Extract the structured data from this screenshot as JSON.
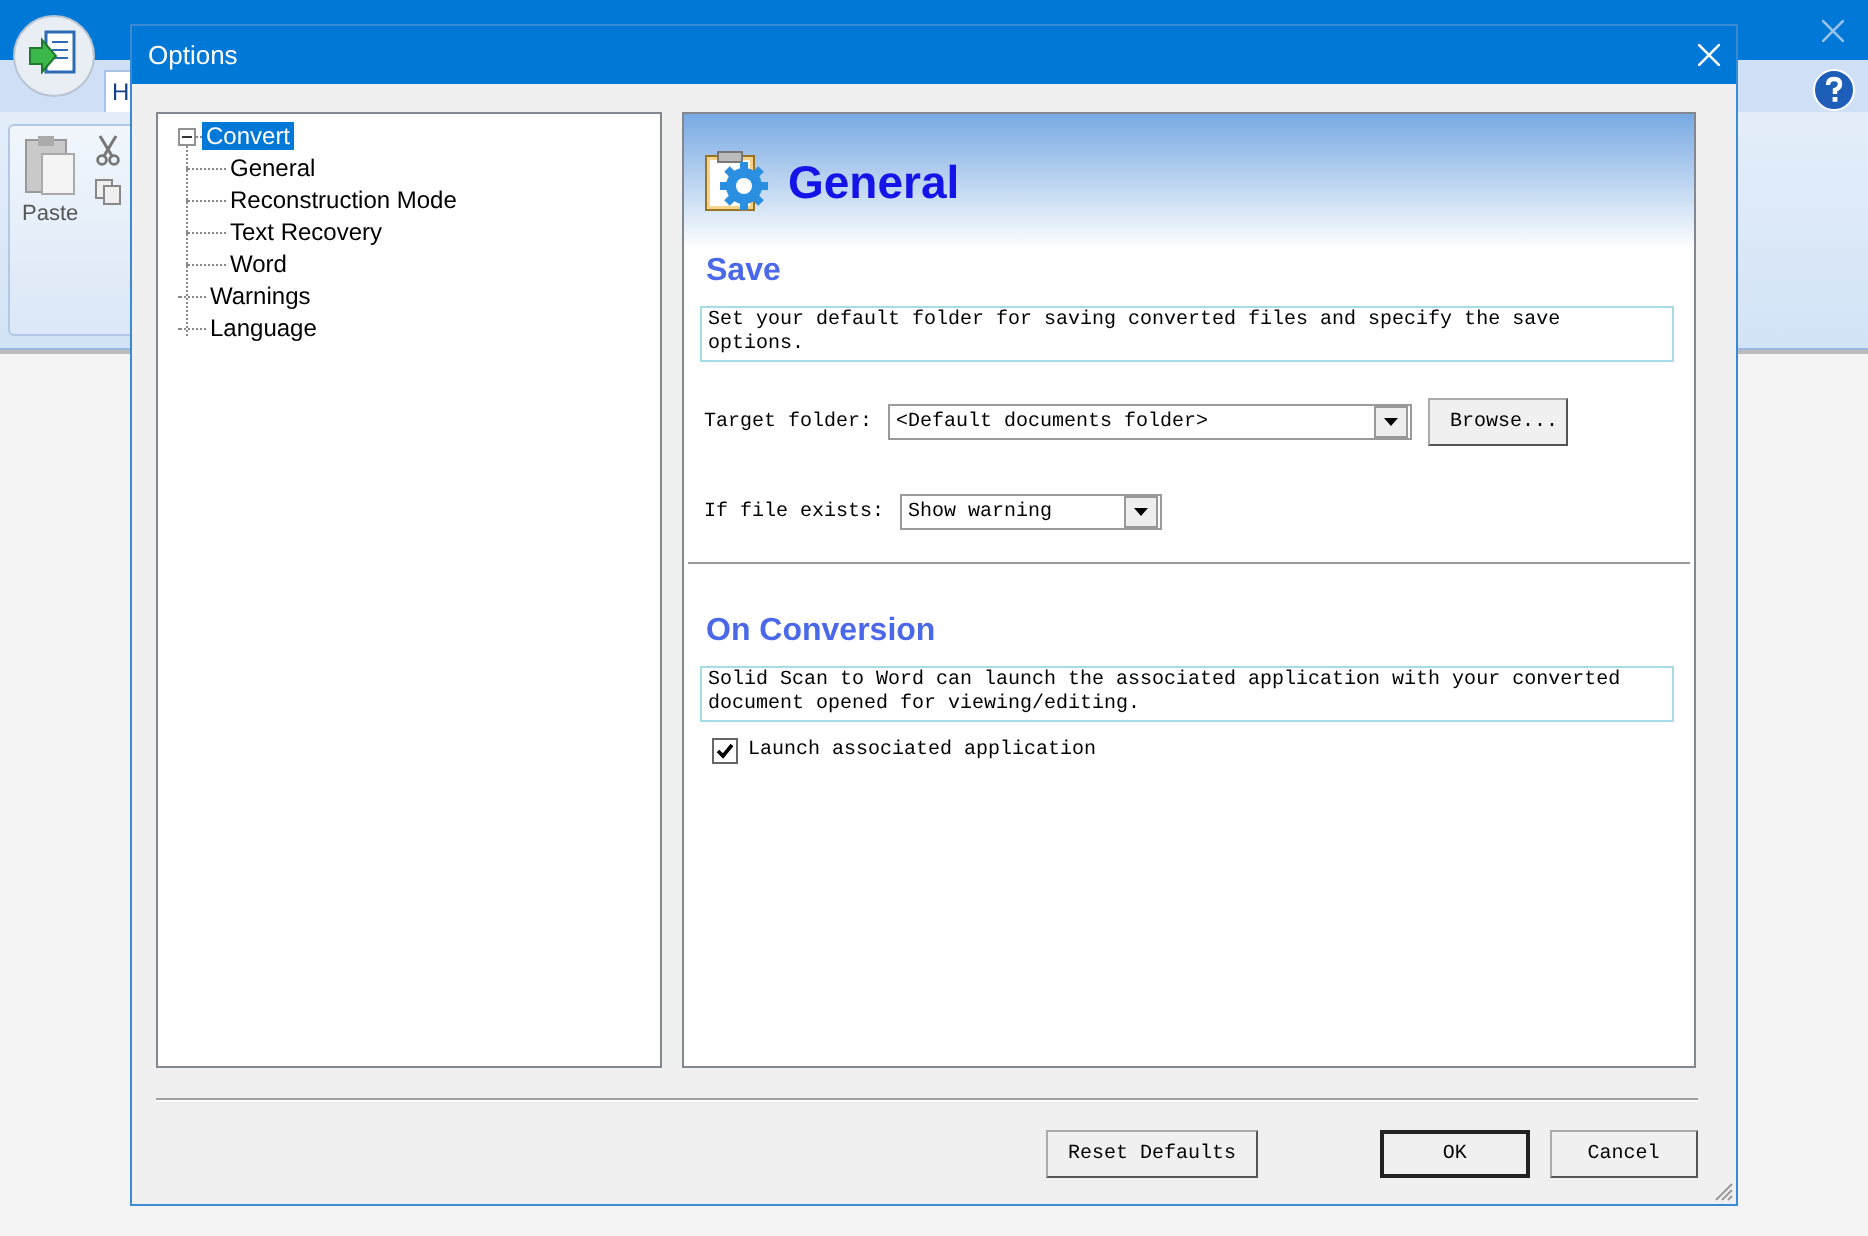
{
  "app": {
    "ribbon_tab": "H",
    "paste_label": "Paste"
  },
  "dialog": {
    "title": "Options"
  },
  "tree": [
    {
      "label": "Convert",
      "selected": true,
      "expanded": true,
      "children": [
        {
          "label": "General",
          "selected": false
        },
        {
          "label": "Reconstruction Mode",
          "selected": false
        },
        {
          "label": "Text Recovery",
          "selected": false
        },
        {
          "label": "Word",
          "selected": false
        }
      ]
    },
    {
      "label": "Warnings",
      "selected": false
    },
    {
      "label": "Language",
      "selected": false
    }
  ],
  "page": {
    "title": "General",
    "sections": [
      {
        "heading": "Save",
        "description": "Set your default folder for saving converted files and specify the save options.",
        "fields": [
          {
            "kind": "folder",
            "label": "Target folder:",
            "value": "<Default documents folder>",
            "button": "Browse..."
          },
          {
            "kind": "dropdown",
            "label": "If file exists:",
            "value": "Show warning"
          }
        ]
      },
      {
        "heading": "On Conversion",
        "description": "Solid Scan to Word can launch the associated application with your converted document opened for viewing/editing.",
        "fields": [
          {
            "kind": "checkbox",
            "label": "Launch associated application",
            "checked": true
          }
        ]
      }
    ]
  },
  "buttons": [
    {
      "label": "Reset Defaults",
      "default": false
    },
    {
      "label": "OK",
      "default": true
    },
    {
      "label": "Cancel",
      "default": false
    }
  ]
}
